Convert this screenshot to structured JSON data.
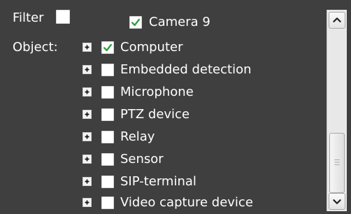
{
  "filter": {
    "label": "Filter",
    "checked": false
  },
  "object": {
    "label": "Object:"
  },
  "tree": {
    "root": {
      "label": "Camera 9",
      "checked": true
    },
    "items": [
      {
        "label": "Computer",
        "checked": true,
        "expandable": true
      },
      {
        "label": "Embedded detection",
        "checked": false,
        "expandable": true
      },
      {
        "label": "Microphone",
        "checked": false,
        "expandable": true
      },
      {
        "label": "PTZ device",
        "checked": false,
        "expandable": true
      },
      {
        "label": "Relay",
        "checked": false,
        "expandable": true
      },
      {
        "label": "Sensor",
        "checked": false,
        "expandable": true
      },
      {
        "label": "SIP-terminal",
        "checked": false,
        "expandable": true
      },
      {
        "label": "Video capture device",
        "checked": false,
        "expandable": true
      }
    ]
  },
  "icons": {
    "check": "check-icon",
    "expand": "plus-icon",
    "scroll_up": "chevron-up-icon",
    "scroll_down": "chevron-down-icon",
    "grip": "grip-icon"
  },
  "colors": {
    "background": "#3f3f3f",
    "check_green": "#2e9e3a",
    "text": "#ffffff"
  }
}
